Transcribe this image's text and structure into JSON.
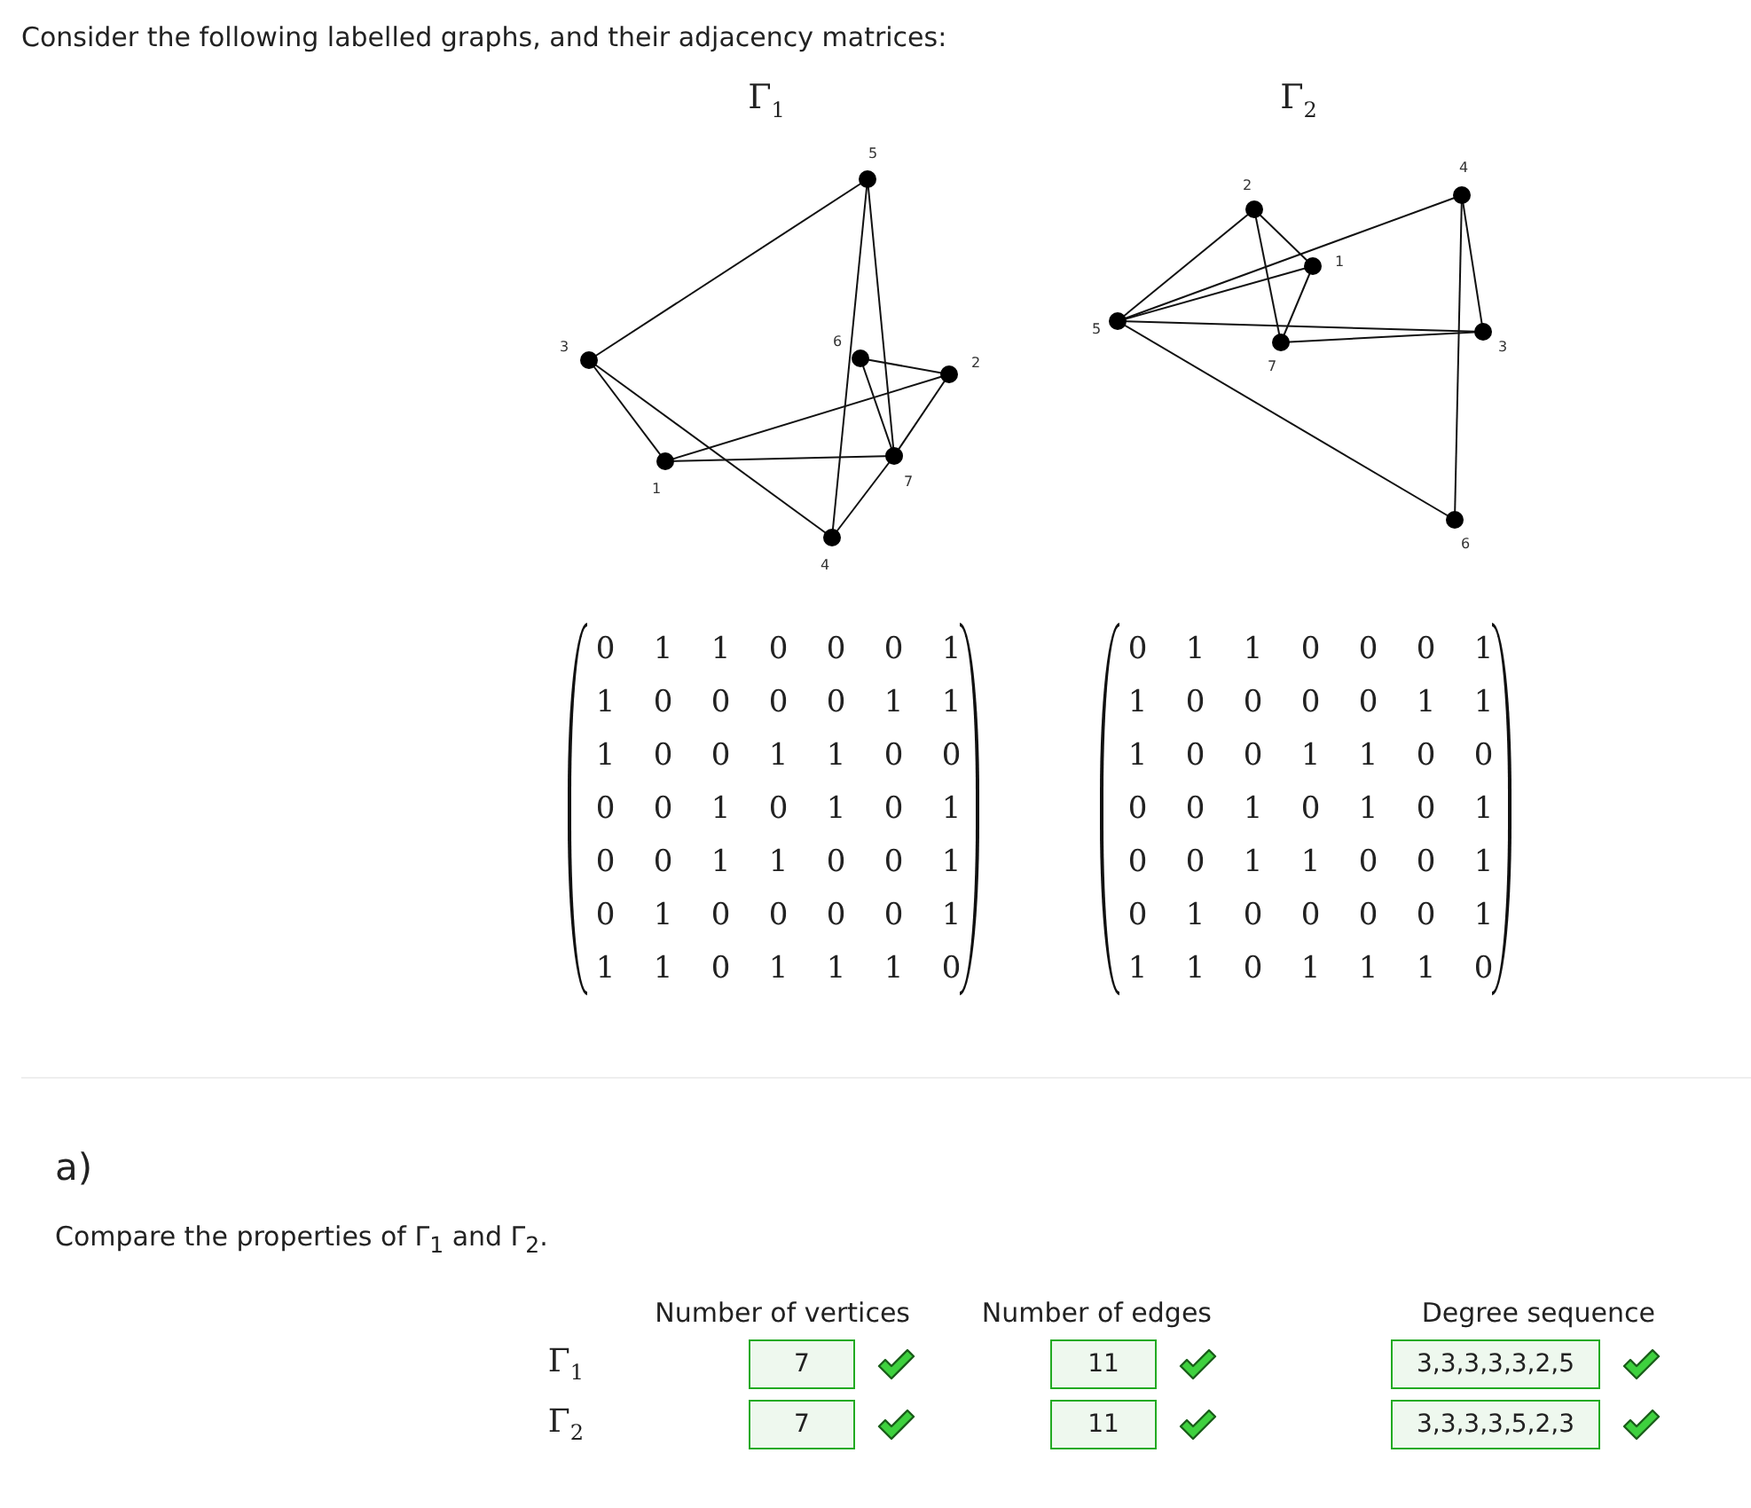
{
  "intro": "Consider the following labelled graphs, and their adjacency matrices:",
  "graphs": [
    {
      "title": "Γ$_{1}$",
      "nodes": [
        "1",
        "2",
        "3",
        "4",
        "5",
        "6",
        "7"
      ],
      "matrix": [
        [
          "0",
          "1",
          "1",
          "0",
          "0",
          "0",
          "1"
        ],
        [
          "1",
          "0",
          "0",
          "0",
          "0",
          "1",
          "1"
        ],
        [
          "1",
          "0",
          "0",
          "1",
          "1",
          "0",
          "0"
        ],
        [
          "0",
          "0",
          "1",
          "0",
          "1",
          "0",
          "1"
        ],
        [
          "0",
          "0",
          "1",
          "1",
          "0",
          "0",
          "1"
        ],
        [
          "0",
          "1",
          "0",
          "0",
          "0",
          "0",
          "1"
        ],
        [
          "1",
          "1",
          "0",
          "1",
          "1",
          "1",
          "0"
        ]
      ]
    },
    {
      "title": "Γ$_{2}$",
      "nodes": [
        "1",
        "2",
        "3",
        "4",
        "5",
        "6",
        "7"
      ],
      "matrix": [
        [
          "0",
          "1",
          "1",
          "0",
          "0",
          "0",
          "1"
        ],
        [
          "1",
          "0",
          "0",
          "0",
          "0",
          "1",
          "1"
        ],
        [
          "1",
          "0",
          "0",
          "1",
          "1",
          "0",
          "0"
        ],
        [
          "0",
          "0",
          "1",
          "0",
          "1",
          "0",
          "1"
        ],
        [
          "0",
          "0",
          "1",
          "1",
          "0",
          "0",
          "1"
        ],
        [
          "0",
          "1",
          "0",
          "0",
          "0",
          "0",
          "1"
        ],
        [
          "1",
          "1",
          "0",
          "1",
          "1",
          "1",
          "0"
        ]
      ]
    }
  ],
  "part": {
    "label": "a)",
    "prompt": "Compare the properties of Γ$_{1}$ and Γ$_{2}$.",
    "columns": [
      "Number of vertices",
      "Number of edges",
      "Degree sequence"
    ],
    "rows": [
      {
        "label": "Γ$_{1}$",
        "answers": [
          {
            "value": "7",
            "correct": true
          },
          {
            "value": "11",
            "correct": true
          },
          {
            "value": "3,3,3,3,3,2,5",
            "correct": true
          }
        ]
      },
      {
        "label": "Γ$_{2}$",
        "answers": [
          {
            "value": "7",
            "correct": true
          },
          {
            "value": "11",
            "correct": true
          },
          {
            "value": "3,3,3,3,5,2,3",
            "correct": true
          }
        ]
      }
    ]
  }
}
